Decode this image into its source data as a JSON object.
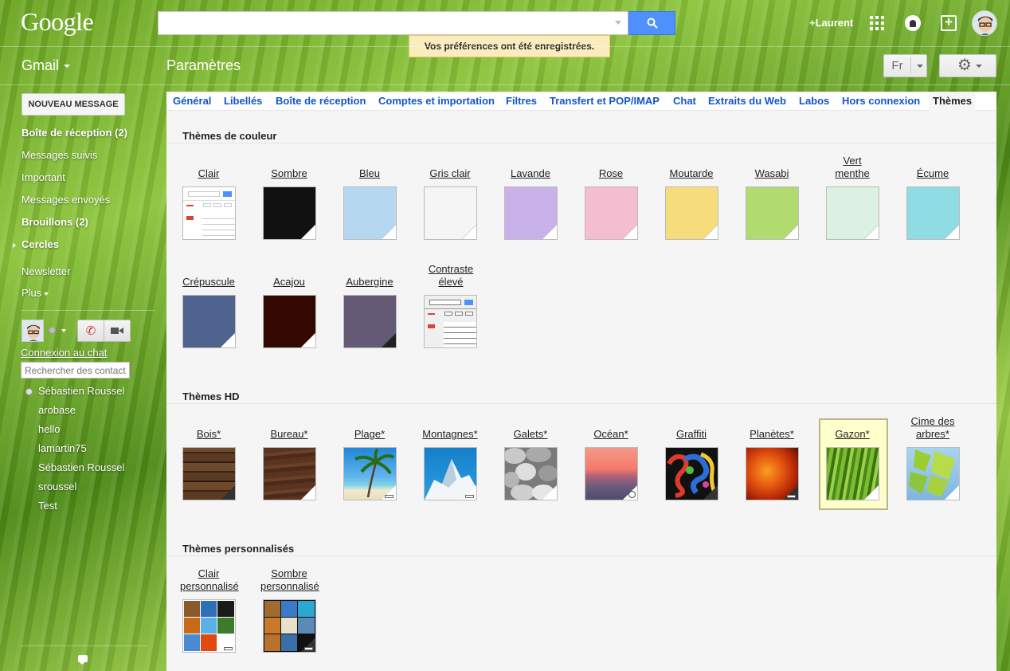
{
  "header": {
    "logo": "Google",
    "search_value": "",
    "notice": "Vos préférences ont été enregistrées.",
    "user_link": "+Laurent"
  },
  "subheader": {
    "app_name": "Gmail",
    "page_title": "Paramètres",
    "lang_button": "Fr"
  },
  "sidebar": {
    "compose": "NOUVEAU MESSAGE",
    "items": [
      {
        "label": "Boîte de réception (2)"
      },
      {
        "label": "Messages suivis"
      },
      {
        "label": "Important"
      },
      {
        "label": "Messages envoyés"
      },
      {
        "label": "Brouillons (2)"
      },
      {
        "label": "Cercles"
      },
      {
        "label": "Newsletter"
      },
      {
        "label": "Plus"
      }
    ],
    "chat_link": "Connexion au chat",
    "contact_search_placeholder": "Rechercher des contacts",
    "contacts": [
      "Sébastien Roussel",
      "arobase",
      "hello",
      "lamartin75",
      "Sébastien Roussel",
      "sroussel",
      "Test"
    ]
  },
  "tabs": [
    "Général",
    "Libellés",
    "Boîte de réception",
    "Comptes et importation",
    "Filtres",
    "Transfert et POP/IMAP",
    "Chat",
    "Extraits du Web",
    "Labos",
    "Hors connexion",
    "Thèmes"
  ],
  "sections": {
    "color": {
      "title": "Thèmes de couleur",
      "themes": [
        {
          "name": "Clair",
          "color": "#ffffff"
        },
        {
          "name": "Sombre",
          "color": "#111111"
        },
        {
          "name": "Bleu",
          "color": "#b6d7f0"
        },
        {
          "name": "Gris clair",
          "color": "#f5f5f5"
        },
        {
          "name": "Lavande",
          "color": "#c9b2ea"
        },
        {
          "name": "Rose",
          "color": "#f5bdd0"
        },
        {
          "name": "Moutarde",
          "color": "#f7dc7b"
        },
        {
          "name": "Wasabi",
          "color": "#b1db6e"
        },
        {
          "name": "Vert menthe",
          "color": "#dcf0e3"
        },
        {
          "name": "Écume",
          "color": "#90dce3"
        },
        {
          "name": "Crépuscule",
          "color": "#50638f"
        },
        {
          "name": "Acajou",
          "color": "#320800"
        },
        {
          "name": "Aubergine",
          "color": "#655a75"
        },
        {
          "name": "Contraste élevé",
          "color": "#f0f0f0"
        }
      ]
    },
    "hd": {
      "title": "Thèmes HD",
      "selected": "Gazon*",
      "themes": [
        {
          "name": "Bois*"
        },
        {
          "name": "Bureau*"
        },
        {
          "name": "Plage*"
        },
        {
          "name": "Montagnes*"
        },
        {
          "name": "Galets*"
        },
        {
          "name": "Océan*"
        },
        {
          "name": "Graffiti"
        },
        {
          "name": "Planètes*"
        },
        {
          "name": "Gazon*"
        },
        {
          "name": "Cime des arbres*"
        }
      ]
    },
    "custom": {
      "title": "Thèmes personnalisés",
      "themes": [
        {
          "name": "Clair personnalisé"
        },
        {
          "name": "Sombre personnalisé"
        }
      ]
    }
  },
  "colors": {
    "accent_blue": "#4d90fe",
    "link_blue": "#1155cc",
    "notice_bg": "#f9edbe"
  }
}
